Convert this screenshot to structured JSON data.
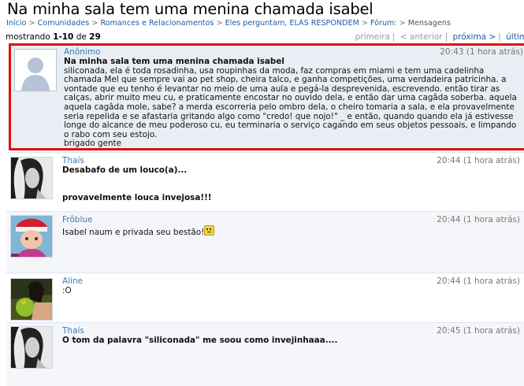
{
  "page": {
    "title": "Na minha sala tem uma menina chamada isabel"
  },
  "breadcrumb": {
    "items": [
      "Início",
      "Comunidades",
      "Romances e Relacionamentos",
      "Eles perguntam, ELAS RESPONDEM",
      "Fórum:"
    ],
    "current": "Mensagens",
    "separator": ">"
  },
  "pager": {
    "prefix": "mostrando ",
    "range": "1-10",
    "of_word": " de ",
    "total": "29",
    "first": "primeira",
    "prev": "< anterior",
    "next": "próxima >",
    "last": "últim"
  },
  "posts": [
    {
      "author": "Anônimo",
      "time": "20:43 (1 hora atrás)",
      "title": "Na minha sala tem uma menina chamada isabel",
      "body": "siliconada, ela é toda rosadinha, usa roupinhas da moda, faz compras em miami e tem uma cadelinha chamada Mel que sempre vai ao pet shop, cheira talco, e ganha competições, uma verdadeira patricinha. a vontade que eu tenho é levantar no meio de uma aula e pegá-la desprevenida, escrevendo. então tirar as calças, abrir muito meu cu, e praticamente encostar no ouvido dela, e então dar uma cagâda soberba. aquela",
      "body2": "aquela cagâda mole, sabe? a merda escorreria pelo ombro dela, o cheiro tomaria a sala, e ela provavelmente seria repelida e se afastaria gritando algo como \"credo! que nojo!\" _ e então, quando quando ela já estivesse longe do alcance de meu poderoso cu, eu terminaria o serviço cagando em seus objetos pessoais, e limpando o rabo com seu estojo.",
      "sign": "brigado gente",
      "avatar": "default-avatar"
    },
    {
      "author": "Thaís",
      "time": "20:44 (1 hora atrás)",
      "line1": "Desabafo de um louco(a)...",
      "line2": "provavelmente louca invejosa!!!",
      "avatar": "photo"
    },
    {
      "author": "Frôblue",
      "time": "20:44 (1 hora atrás)",
      "line1": "Isabel naum e privada seu bestão!",
      "emoji": "smiley-icon",
      "avatar": "photo"
    },
    {
      "author": "Aline",
      "time": "20:44 (1 hora atrás)",
      "line1": ":O",
      "avatar": "photo"
    },
    {
      "author": "Thaís",
      "time": "20:45 (1 hora atrás)",
      "line1": "O tom da palavra \"siliconada\" me soou como invejinhaaa....",
      "avatar": "photo"
    }
  ],
  "colors": {
    "link": "#1d5aa8",
    "author": "#3a7ab5",
    "highlight_border": "#e01010",
    "highlight_bg": "#e9eef5"
  }
}
